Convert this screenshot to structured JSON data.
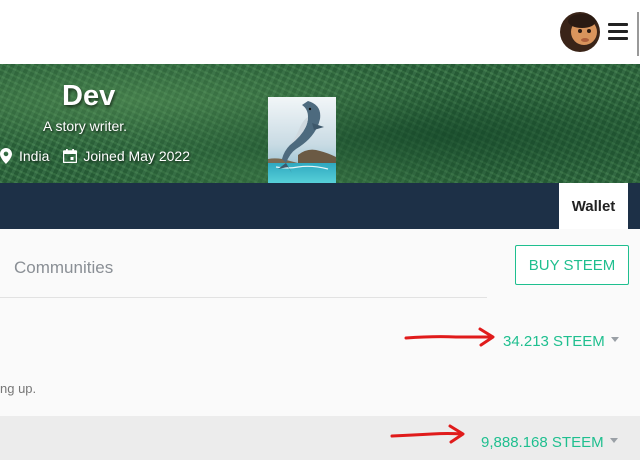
{
  "header": {
    "avatar_icon": "user-avatar",
    "menu_icon": "hamburger-menu-icon"
  },
  "profile": {
    "name": "Dev",
    "about": "A story writer.",
    "location": "India",
    "joined": "Joined May 2022",
    "cover_color": "#2e6a3e"
  },
  "nav": {
    "active_tab": "Wallet",
    "bar_color": "#1d3047"
  },
  "wallet": {
    "tab_communities": "Communities",
    "buy_button": "BUY STEEM",
    "rows": [
      {
        "balance": "34.213 STEEM",
        "description_fragment": "ng up."
      },
      {
        "balance": "9,888.168 STEEM"
      }
    ],
    "accent_color": "#1fbf8f",
    "annotation_color": "#e01b1b"
  }
}
